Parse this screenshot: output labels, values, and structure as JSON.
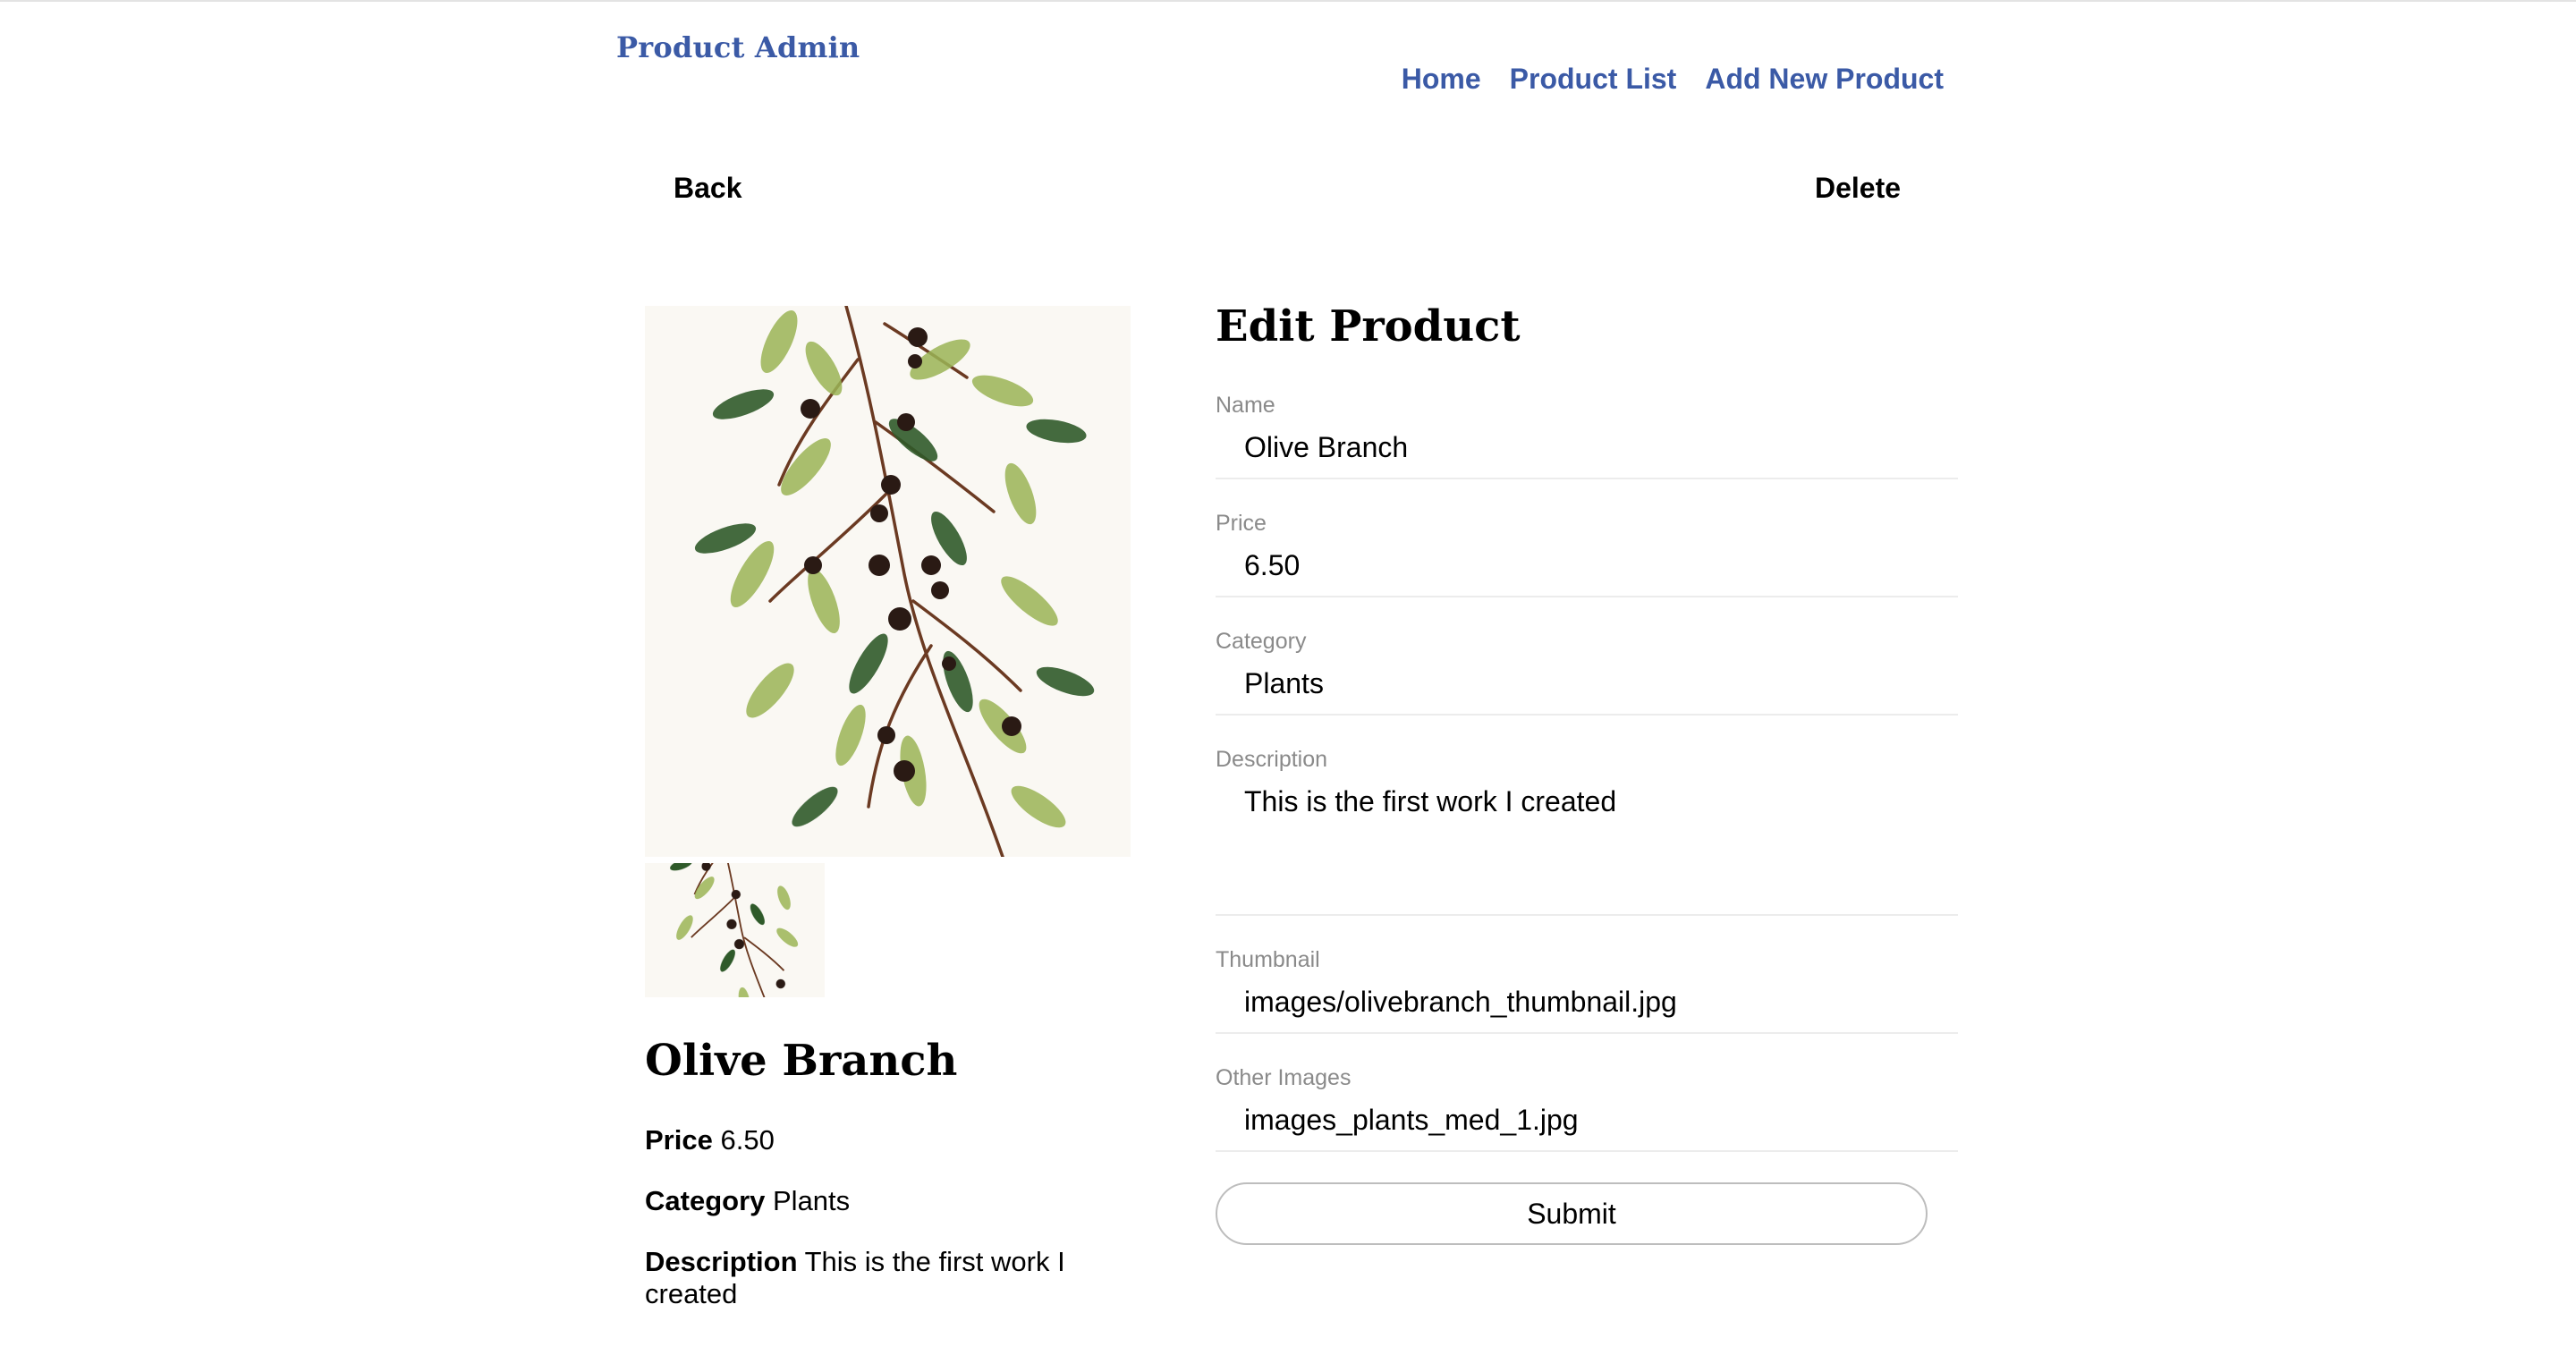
{
  "header": {
    "brand": "Product Admin",
    "nav": [
      "Home",
      "Product List",
      "Add New Product"
    ]
  },
  "actions": {
    "back": "Back",
    "delete": "Delete"
  },
  "product": {
    "name": "Olive Branch",
    "price_label": "Price",
    "price": "6.50",
    "category_label": "Category",
    "category": "Plants",
    "description_label": "Description",
    "description": "This is the first work I created"
  },
  "form": {
    "title": "Edit Product",
    "fields": [
      {
        "label": "Name",
        "value": "Olive Branch"
      },
      {
        "label": "Price",
        "value": "6.50"
      },
      {
        "label": "Category",
        "value": "Plants"
      },
      {
        "label": "Description",
        "value": "This is the first work I created"
      },
      {
        "label": "Thumbnail",
        "value": "images/olivebranch_thumbnail.jpg"
      },
      {
        "label": "Other Images",
        "value": "images_plants_med_1.jpg"
      }
    ],
    "submit": "Submit"
  },
  "images": {
    "main": "olive-branch-watercolor",
    "thumbnail": "olive-branch-watercolor"
  },
  "colors": {
    "brand": "#3b5aa6",
    "field_label": "#8a8a8a",
    "divider": "#ececec"
  }
}
